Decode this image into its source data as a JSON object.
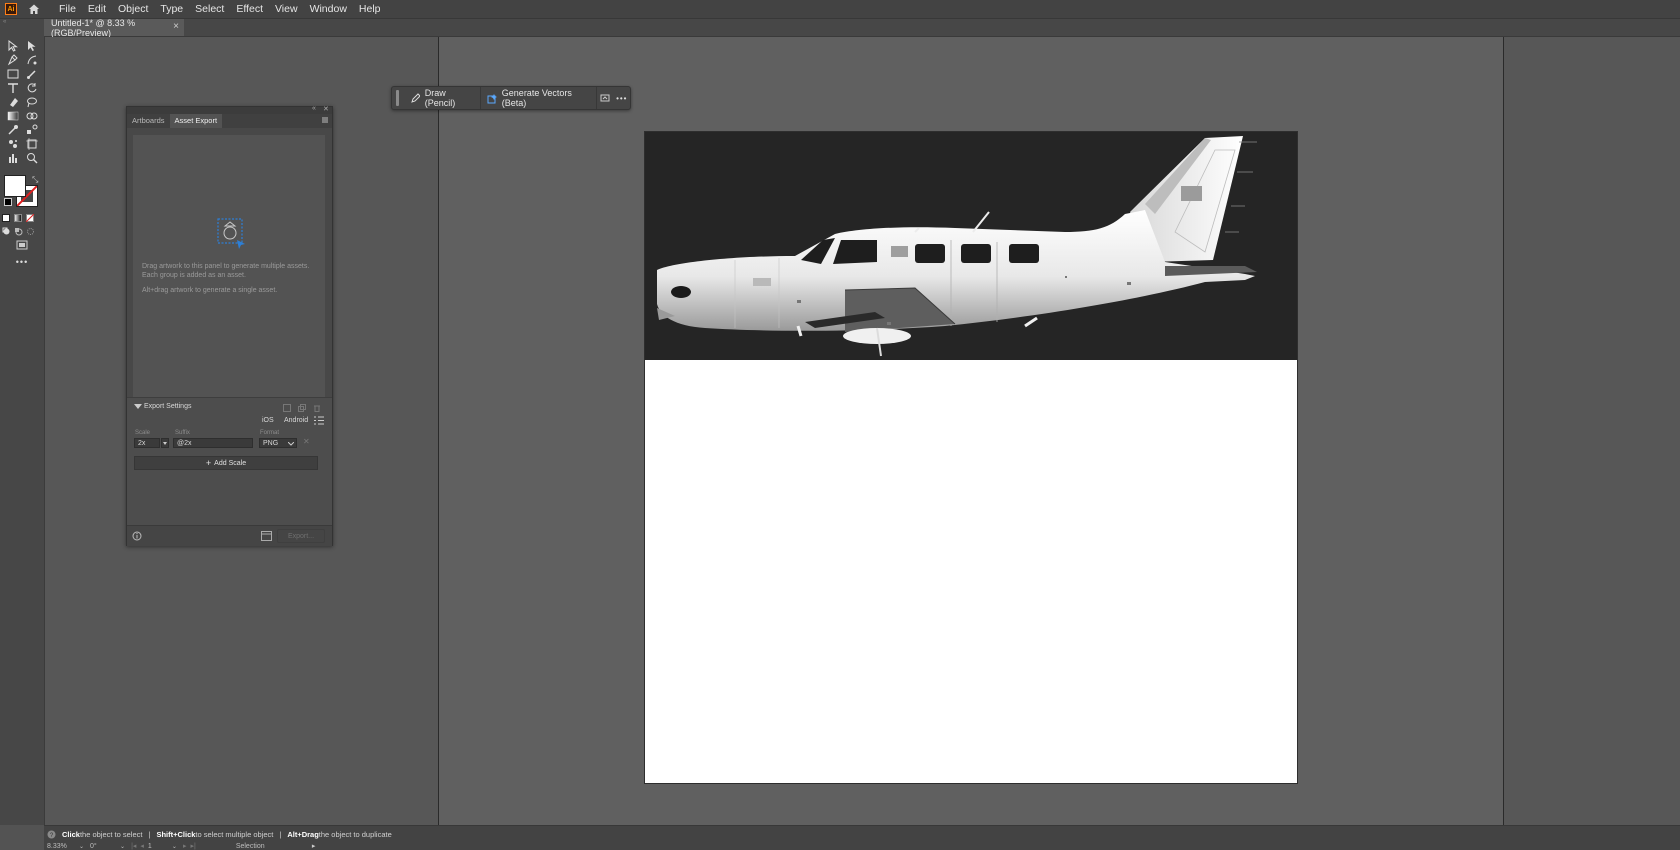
{
  "app": {
    "logo_text": "Ai",
    "home_icon": "home-icon"
  },
  "menu": [
    "File",
    "Edit",
    "Object",
    "Type",
    "Select",
    "Effect",
    "View",
    "Window",
    "Help"
  ],
  "document_tab": {
    "title": "Untitled-1* @ 8.33 % (RGB/Preview)",
    "close": "×"
  },
  "contextual_bar": {
    "draw_label": "Draw (Pencil)",
    "vectors_label": "Generate Vectors (Beta)",
    "more": "•••"
  },
  "panel": {
    "tabs": [
      "Artboards",
      "Asset Export"
    ],
    "active_tab": "Asset Export",
    "drop_text_1": "Drag artwork to this panel to generate multiple assets. Each group is added as an asset.",
    "drop_text_2": "Alt+drag artwork to generate a single asset.",
    "export_settings_label": "Export Settings",
    "platforms": [
      "iOS",
      "Android"
    ],
    "col_scale": "Scale",
    "col_suffix": "Suffix",
    "col_format": "Format",
    "scale_value": "2x",
    "suffix_value": "@2x",
    "format_value": "PNG",
    "add_scale_label": "Add Scale",
    "export_label": "Export..."
  },
  "status": {
    "hint_click": "Click",
    "hint_click_text": " the object to select",
    "hint_shift": "Shift+Click",
    "hint_shift_text": " to select multiple object",
    "hint_alt": "Alt+Drag",
    "hint_alt_text": " the object to duplicate",
    "separator": "|",
    "zoom": "8.33%",
    "rotation": "0°",
    "artboard_number": "1",
    "mode": "Selection"
  },
  "colors": {
    "artboard_bg": "#ffffff",
    "artwork_bg": "#252525",
    "accent": "#2d7fd6"
  }
}
